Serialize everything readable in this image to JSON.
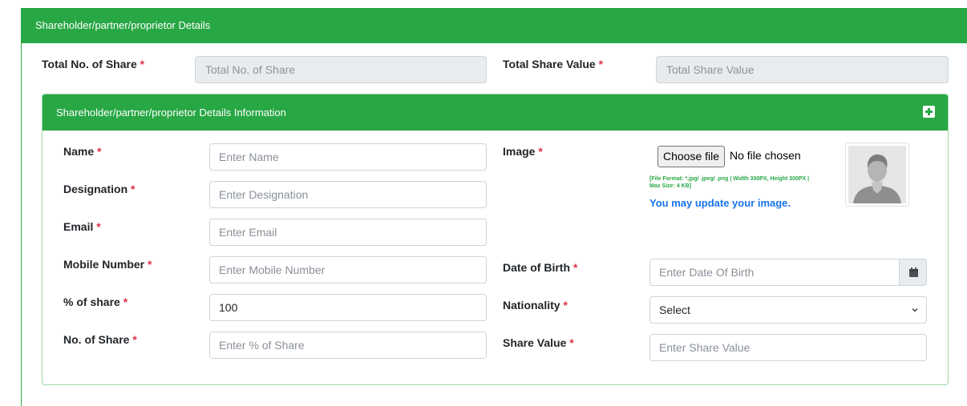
{
  "outer": {
    "title": "Shareholder/partner/proprietor Details"
  },
  "top": {
    "total_shares_label": "Total No. of Share",
    "total_shares_placeholder": "Total No. of Share",
    "total_value_label": "Total Share Value",
    "total_value_placeholder": "Total Share Value"
  },
  "inner": {
    "title": "Shareholder/partner/proprietor Details Information",
    "add_icon": "plus-square-icon"
  },
  "form": {
    "name_label": "Name",
    "name_placeholder": "Enter Name",
    "designation_label": "Designation",
    "designation_placeholder": "Enter Designation",
    "email_label": "Email",
    "email_placeholder": "Enter Email",
    "mobile_label": "Mobile Number",
    "mobile_placeholder": "Enter Mobile Number",
    "share_pct_label": "% of share",
    "share_pct_value": "100",
    "num_share_label": "No. of Share",
    "num_share_placeholder": "Enter % of Share",
    "image_label": "Image",
    "file_button": "Choose file",
    "file_status": "No file chosen",
    "file_note": "[File Format: *.jpg/ .jpeg/ .png | Width 300PX, Height 300PX | Max Size: 4 KB]",
    "update_text": "You may update your image.",
    "dob_label": "Date of Birth",
    "dob_placeholder": "Enter Date Of Birth",
    "nationality_label": "Nationality",
    "nationality_value": "Select",
    "share_value_label": "Share Value",
    "share_value_placeholder": "Enter Share Value",
    "required_mark": "*"
  },
  "colors": {
    "accent": "#28a745",
    "required": "#dc3545",
    "link": "#1a73e8"
  }
}
